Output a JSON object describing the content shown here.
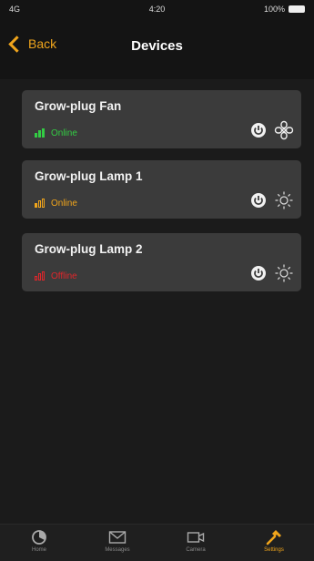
{
  "status_bar": {
    "carrier": "4G",
    "time": "4:20",
    "battery": "100%"
  },
  "nav": {
    "back_label": "Back",
    "title": "Devices"
  },
  "devices": [
    {
      "name": "Grow-plug Fan",
      "status": "Online",
      "status_color": "#33cc44",
      "signal_level": 3,
      "type_icon": "fan-icon"
    },
    {
      "name": "Grow-plug Lamp 1",
      "status": "Online",
      "status_color": "#f0a51c",
      "signal_level": 1,
      "type_icon": "sun-icon"
    },
    {
      "name": "Grow-plug Lamp 2",
      "status": "Offline",
      "status_color": "#e0262b",
      "signal_level": 0,
      "type_icon": "sun-icon"
    }
  ],
  "tab_bar": {
    "tabs": [
      {
        "label": "Home",
        "icon": "home-icon"
      },
      {
        "label": "Messages",
        "icon": "mail-icon"
      },
      {
        "label": "Camera",
        "icon": "camera-icon"
      },
      {
        "label": "Settings",
        "icon": "hammer-icon",
        "active": true
      }
    ]
  },
  "colors": {
    "accent": "#f0a51c",
    "card": "#3b3b3b",
    "background": "#141414"
  }
}
